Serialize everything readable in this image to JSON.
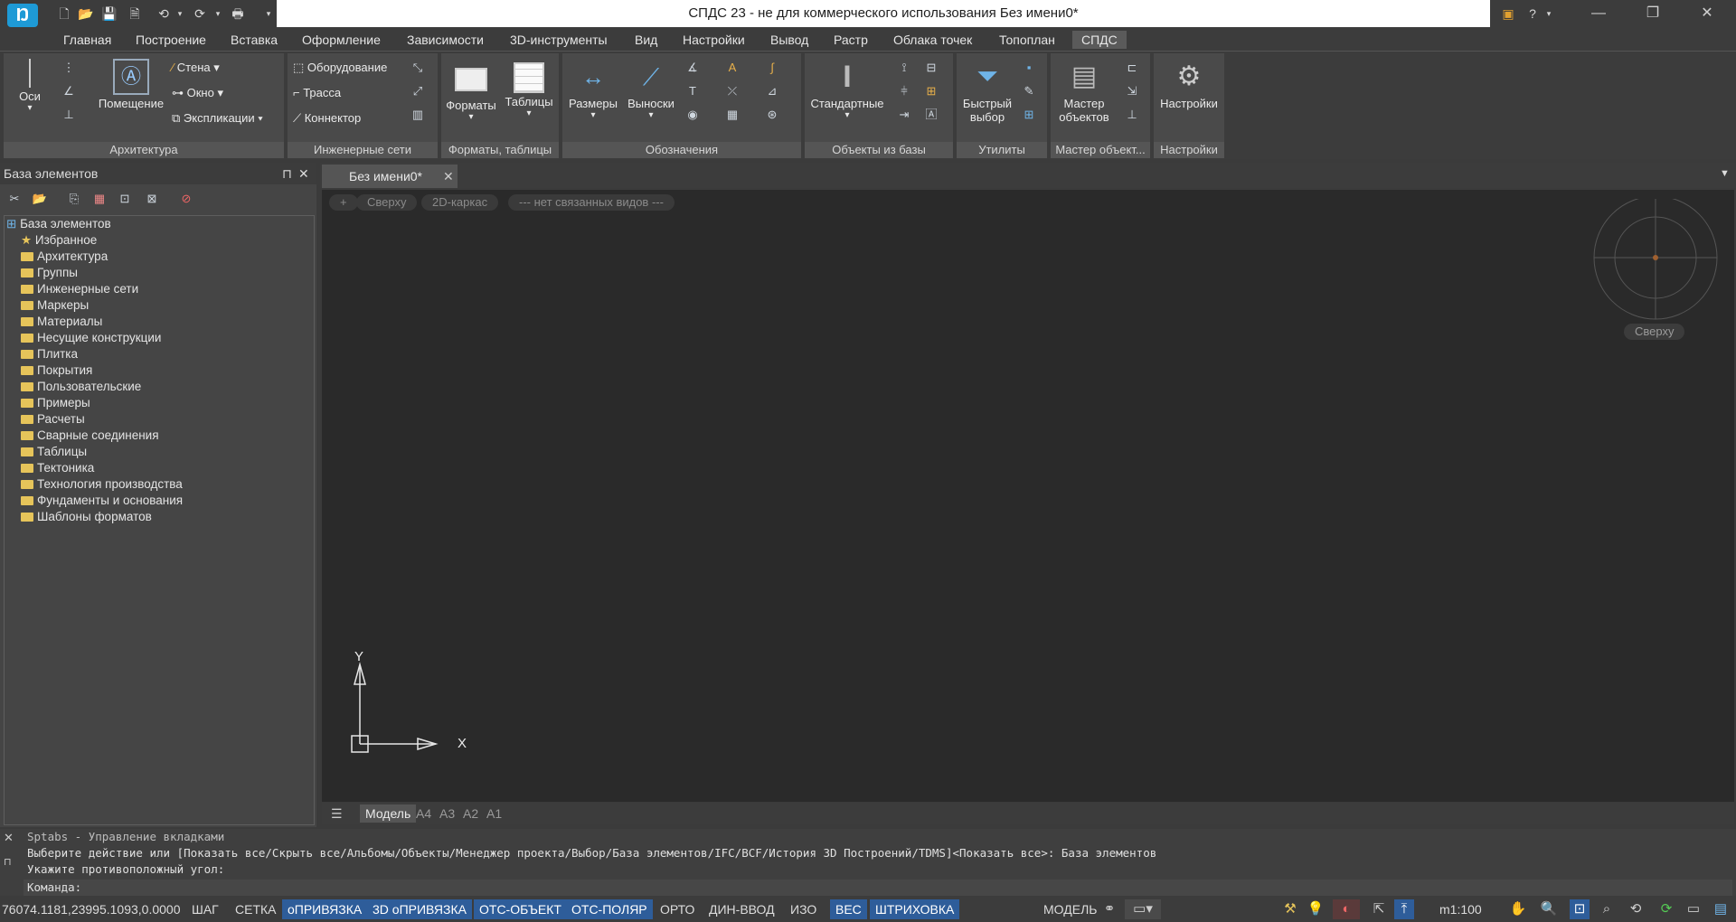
{
  "window": {
    "title": "СПДС 23 - не для коммерческого использования Без имени0*"
  },
  "menu": [
    "Главная",
    "Построение",
    "Вставка",
    "Оформление",
    "Зависимости",
    "3D-инструменты",
    "Вид",
    "Настройки",
    "Вывод",
    "Растр",
    "Облака точек",
    "Топоплан",
    "СПДС"
  ],
  "ribbon": {
    "arch": {
      "label": "Архитектура",
      "axes": "Оси",
      "room": "Помещение",
      "wall": "Стена",
      "window": "Окно",
      "explic": "Экспликации"
    },
    "eng": {
      "label": "Инженерные сети",
      "equipment": "Оборудование",
      "route": "Трасса",
      "connector": "Коннектор"
    },
    "formats": {
      "label": "Форматы, таблицы",
      "formats": "Форматы",
      "tables": "Таблицы"
    },
    "notation": {
      "label": "Обозначения",
      "dims": "Размеры",
      "leaders": "Выноски"
    },
    "base": {
      "label": "Объекты из базы",
      "standard": "Стандартные"
    },
    "utils": {
      "label": "Утилиты",
      "quick1": "Быстрый",
      "quick2": "выбор"
    },
    "master": {
      "label": "Мастер объект...",
      "m1": "Мастер",
      "m2": "объектов"
    },
    "settings": {
      "label": "Настройки",
      "btn": "Настройки"
    }
  },
  "palette": {
    "title": "База элементов",
    "root": "База элементов",
    "items": [
      "Избранное",
      "Архитектура",
      "Группы",
      "Инженерные сети",
      "Маркеры",
      "Материалы",
      "Несущие конструкции",
      "Плитка",
      "Покрытия",
      "Пользовательские",
      "Примеры",
      "Расчеты",
      "Сварные соединения",
      "Таблицы",
      "Тектоника",
      "Технология производства",
      "Фундаменты и основания",
      "Шаблоны форматов"
    ]
  },
  "doc": {
    "tab": "Без имени0*",
    "pills": [
      "+",
      "Сверху",
      "2D-каркас",
      "--- нет связанных видов ---"
    ],
    "viewcube": "Сверху",
    "axis_x": "X",
    "axis_y": "Y"
  },
  "layouts": [
    "Модель",
    "A4",
    "A3",
    "A2",
    "A1"
  ],
  "command": {
    "line1": "Sptabs - Управление вкладками",
    "line2": "Выберите действие или [Показать все/Скрыть все/Альбомы/Объекты/Менеджер проекта/Выбор/База элементов/IFC/BCF/История 3D Построений/TDMS]<Показать все>: База элементов",
    "line3": "Укажите противоположный угол:",
    "prompt": "Команда:"
  },
  "status": {
    "coords": "76074.1181,23995.1093,0.0000",
    "toggles": [
      "ШАГ",
      "СЕТКА",
      "оПРИВЯЗКА",
      "3D оПРИВЯЗКА",
      "ОТС-ОБЪЕКТ",
      "ОТС-ПОЛЯР",
      "ОРТО",
      "ДИН-ВВОД",
      "ИЗО",
      "ВЕС",
      "ШТРИХОВКА"
    ],
    "space": "МОДЕЛЬ",
    "scale": "m1:100"
  }
}
